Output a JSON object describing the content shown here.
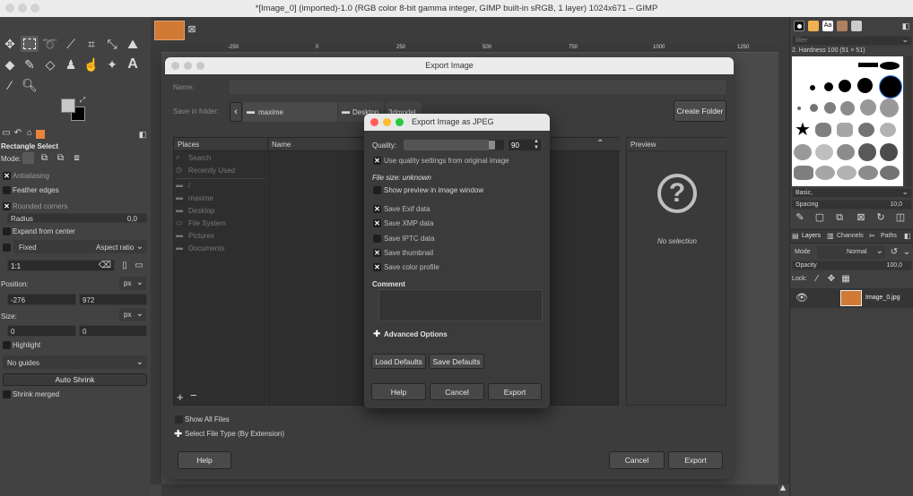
{
  "window": {
    "title": "*[Image_0] (imported)-1.0 (RGB color 8-bit gamma integer, GIMP built-in sRGB, 1 layer) 1024x671 – GIMP"
  },
  "ruler": {
    "ticks": [
      "-250",
      "0",
      "250",
      "500",
      "750",
      "1000",
      "1250"
    ]
  },
  "toolbox": {
    "tool_title": "Rectangle Select",
    "mode_label": "Mode:",
    "antialiasing": "Antialiasing",
    "feather_edges": "Feather edges",
    "rounded_corners": "Rounded corners",
    "radius_label": "Radius",
    "radius_value": "0,0",
    "expand_from_center": "Expand from center",
    "fixed_label": "Fixed",
    "aspect_ratio": "Aspect ratio",
    "ratio_value": "1:1",
    "position_label": "Position:",
    "unit": "px",
    "pos_x": "-276",
    "pos_y": "972",
    "size_label": "Size:",
    "size_w": "0",
    "size_h": "0",
    "highlight": "Highlight",
    "guides": "No guides",
    "auto_shrink": "Auto Shrink",
    "shrink_merged": "Shrink merged"
  },
  "export_dialog": {
    "title": "Export Image",
    "name_label": "Name:",
    "save_in_label": "Save in folder:",
    "path": [
      "maxime",
      "Desktop",
      "3dmodel"
    ],
    "create_folder": "Create Folder",
    "places_header": "Places",
    "places": [
      "Search",
      "Recently Used",
      "/",
      "maxime",
      "Desktop",
      "File System",
      "Pictures",
      "Documents"
    ],
    "name_col": "Name",
    "preview_header": "Preview",
    "no_selection": "No selection",
    "show_all_files": "Show All Files",
    "select_file_type": "Select File Type (By Extension)",
    "help": "Help",
    "cancel": "Cancel",
    "export": "Export"
  },
  "jpeg_dialog": {
    "title": "Export Image as JPEG",
    "quality_label": "Quality:",
    "quality_value": "90",
    "quality_level": 0.9,
    "use_quality_settings": "Use quality settings from original image",
    "file_size": "File size: unknown",
    "show_preview": "Show preview in image window",
    "save_exif": "Save Exif data",
    "save_xmp": "Save XMP data",
    "save_iptc": "Save IPTC data",
    "save_thumbnail": "Save thumbnail",
    "save_color_profile": "Save color profile",
    "comment_label": "Comment",
    "advanced_options": "Advanced Options",
    "load_defaults": "Load Defaults",
    "save_defaults": "Save Defaults",
    "help": "Help",
    "cancel": "Cancel",
    "export": "Export"
  },
  "right_panel": {
    "filter_placeholder": "filter",
    "brush_name": "2. Hardness 100 (51 × 51)",
    "preset": "Basic,",
    "spacing_label": "Spacing",
    "spacing_value": "10,0",
    "tabs": [
      "Layers",
      "Channels",
      "Paths"
    ],
    "mode_label": "Mode",
    "mode_value": "Normal",
    "opacity_label": "Opacity",
    "opacity_value": "100,0",
    "lock_label": "Lock:",
    "layer_name": "Image_0.jpg"
  },
  "colors": {
    "accent": "#e8833a",
    "red": "#ff5f57",
    "yellow": "#febc2e",
    "green": "#28c840"
  }
}
